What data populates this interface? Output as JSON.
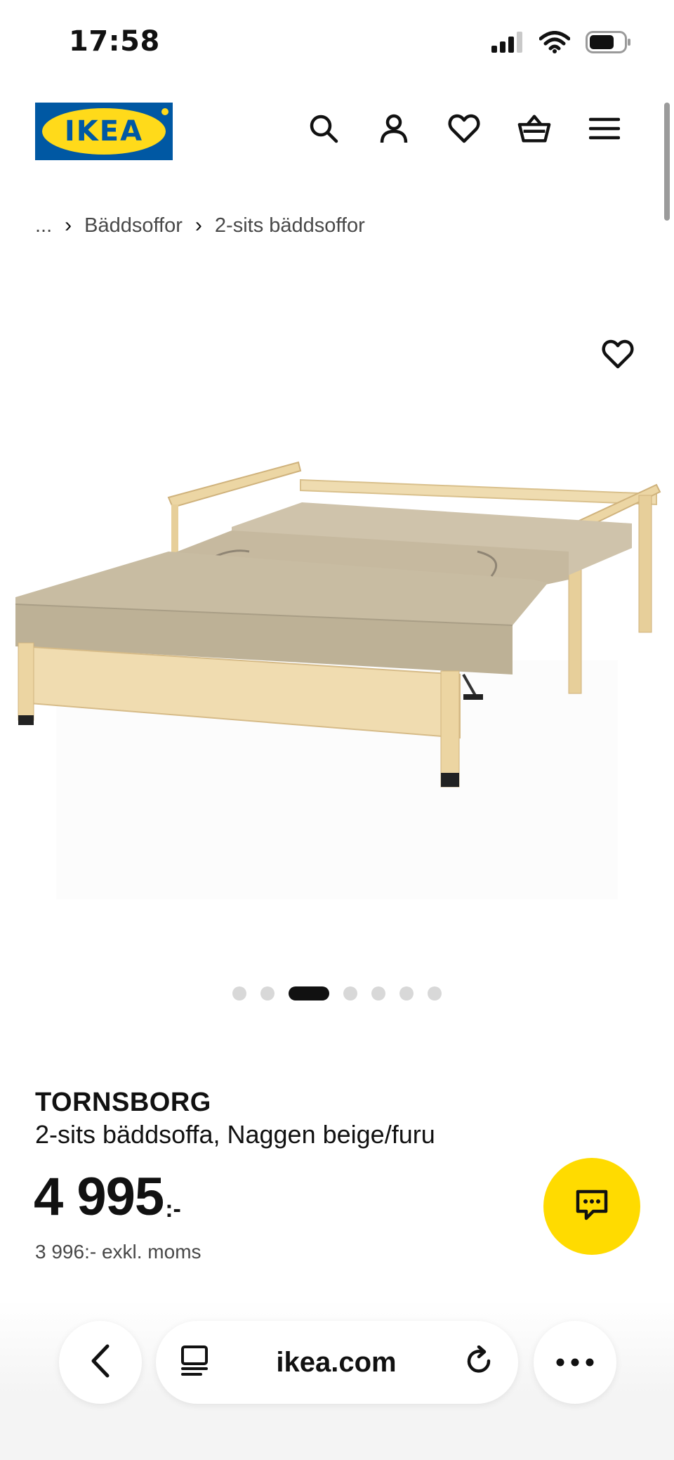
{
  "status_bar": {
    "time": "17:58",
    "icons": [
      "signal-icon",
      "wifi-icon",
      "battery-icon"
    ]
  },
  "header": {
    "logo_text": "IKEA",
    "icons": [
      "search-icon",
      "account-icon",
      "heart-icon",
      "cart-icon",
      "menu-icon"
    ],
    "brand_colors": {
      "blue": "#0058a3",
      "yellow": "#ffda1a"
    }
  },
  "breadcrumb": {
    "items": [
      "...",
      "Bäddsoffor",
      "2-sits bäddsoffor"
    ],
    "separator": "›"
  },
  "gallery": {
    "image_alt": "Sofa bed in unfolded bed position",
    "dot_count": 7,
    "active_index": 2
  },
  "product": {
    "name": "TORNSBORG",
    "description": "2-sits bäddsoffa, Naggen beige/furu",
    "price": "4 995",
    "price_suffix": ":-",
    "price_excl_vat": "3 996:- exkl. moms"
  },
  "browser_bar": {
    "url": "ikea.com",
    "icons": [
      "back-icon",
      "tabs-icon",
      "reload-icon",
      "more-icon"
    ]
  }
}
